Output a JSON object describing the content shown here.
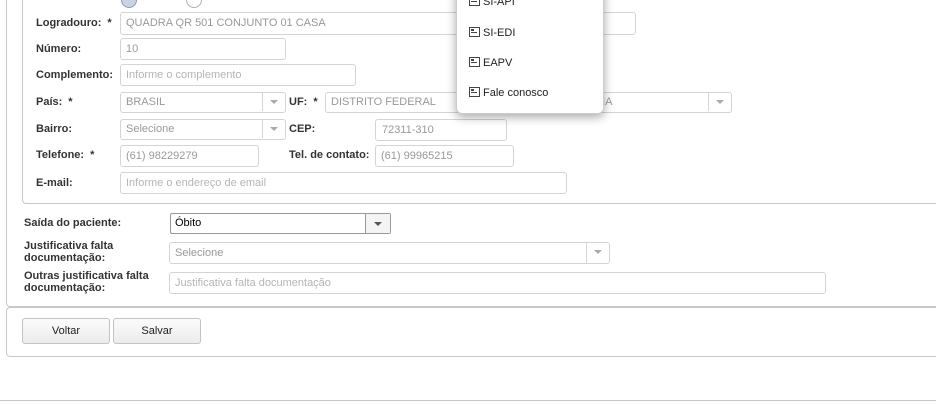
{
  "address": {
    "logradouro": {
      "label": "Logradouro:",
      "required": "*",
      "value": "QUADRA QR 501 CONJUNTO 01 CASA"
    },
    "numero": {
      "label": "Número:",
      "value": "10"
    },
    "complemento": {
      "label": "Complemento:",
      "placeholder": "Informe o complemento"
    },
    "pais": {
      "label": "País:",
      "required": "*",
      "value": "BRASIL"
    },
    "uf": {
      "label": "UF:",
      "required": "*",
      "value": "DISTRITO FEDERAL"
    },
    "municipio": {
      "value": "LIA"
    },
    "bairro": {
      "label": "Bairro:",
      "value": "Selecione"
    },
    "cep": {
      "label": "CEP:",
      "value": "72311-310"
    },
    "telefone": {
      "label": "Telefone:",
      "required": "*",
      "value": "(61) 98229279"
    },
    "tel_contato": {
      "label": "Tel. de contato:",
      "value": "(61) 99965215"
    },
    "email": {
      "label": "E-mail:",
      "placeholder": "Informe o endereço de email"
    }
  },
  "discharge": {
    "saida": {
      "label": "Saída do paciente:",
      "value": "Óbito"
    },
    "justificativa": {
      "label_line1": "Justificativa falta",
      "label_line2": "documentação:",
      "value": "Selecione"
    },
    "outras": {
      "label_line1": "Outras justificativa falta",
      "label_line2": "documentação:",
      "placeholder": "Justificativa falta documentação"
    }
  },
  "buttons": {
    "voltar": "Voltar",
    "salvar": "Salvar"
  },
  "menu": {
    "items": [
      {
        "label": "SI-API",
        "icon": "id-card-icon"
      },
      {
        "label": "SI-EDI",
        "icon": "id-card-icon"
      },
      {
        "label": "EAPV",
        "icon": "id-card-icon"
      },
      {
        "label": "Fale conosco",
        "icon": "id-card-icon"
      }
    ]
  }
}
